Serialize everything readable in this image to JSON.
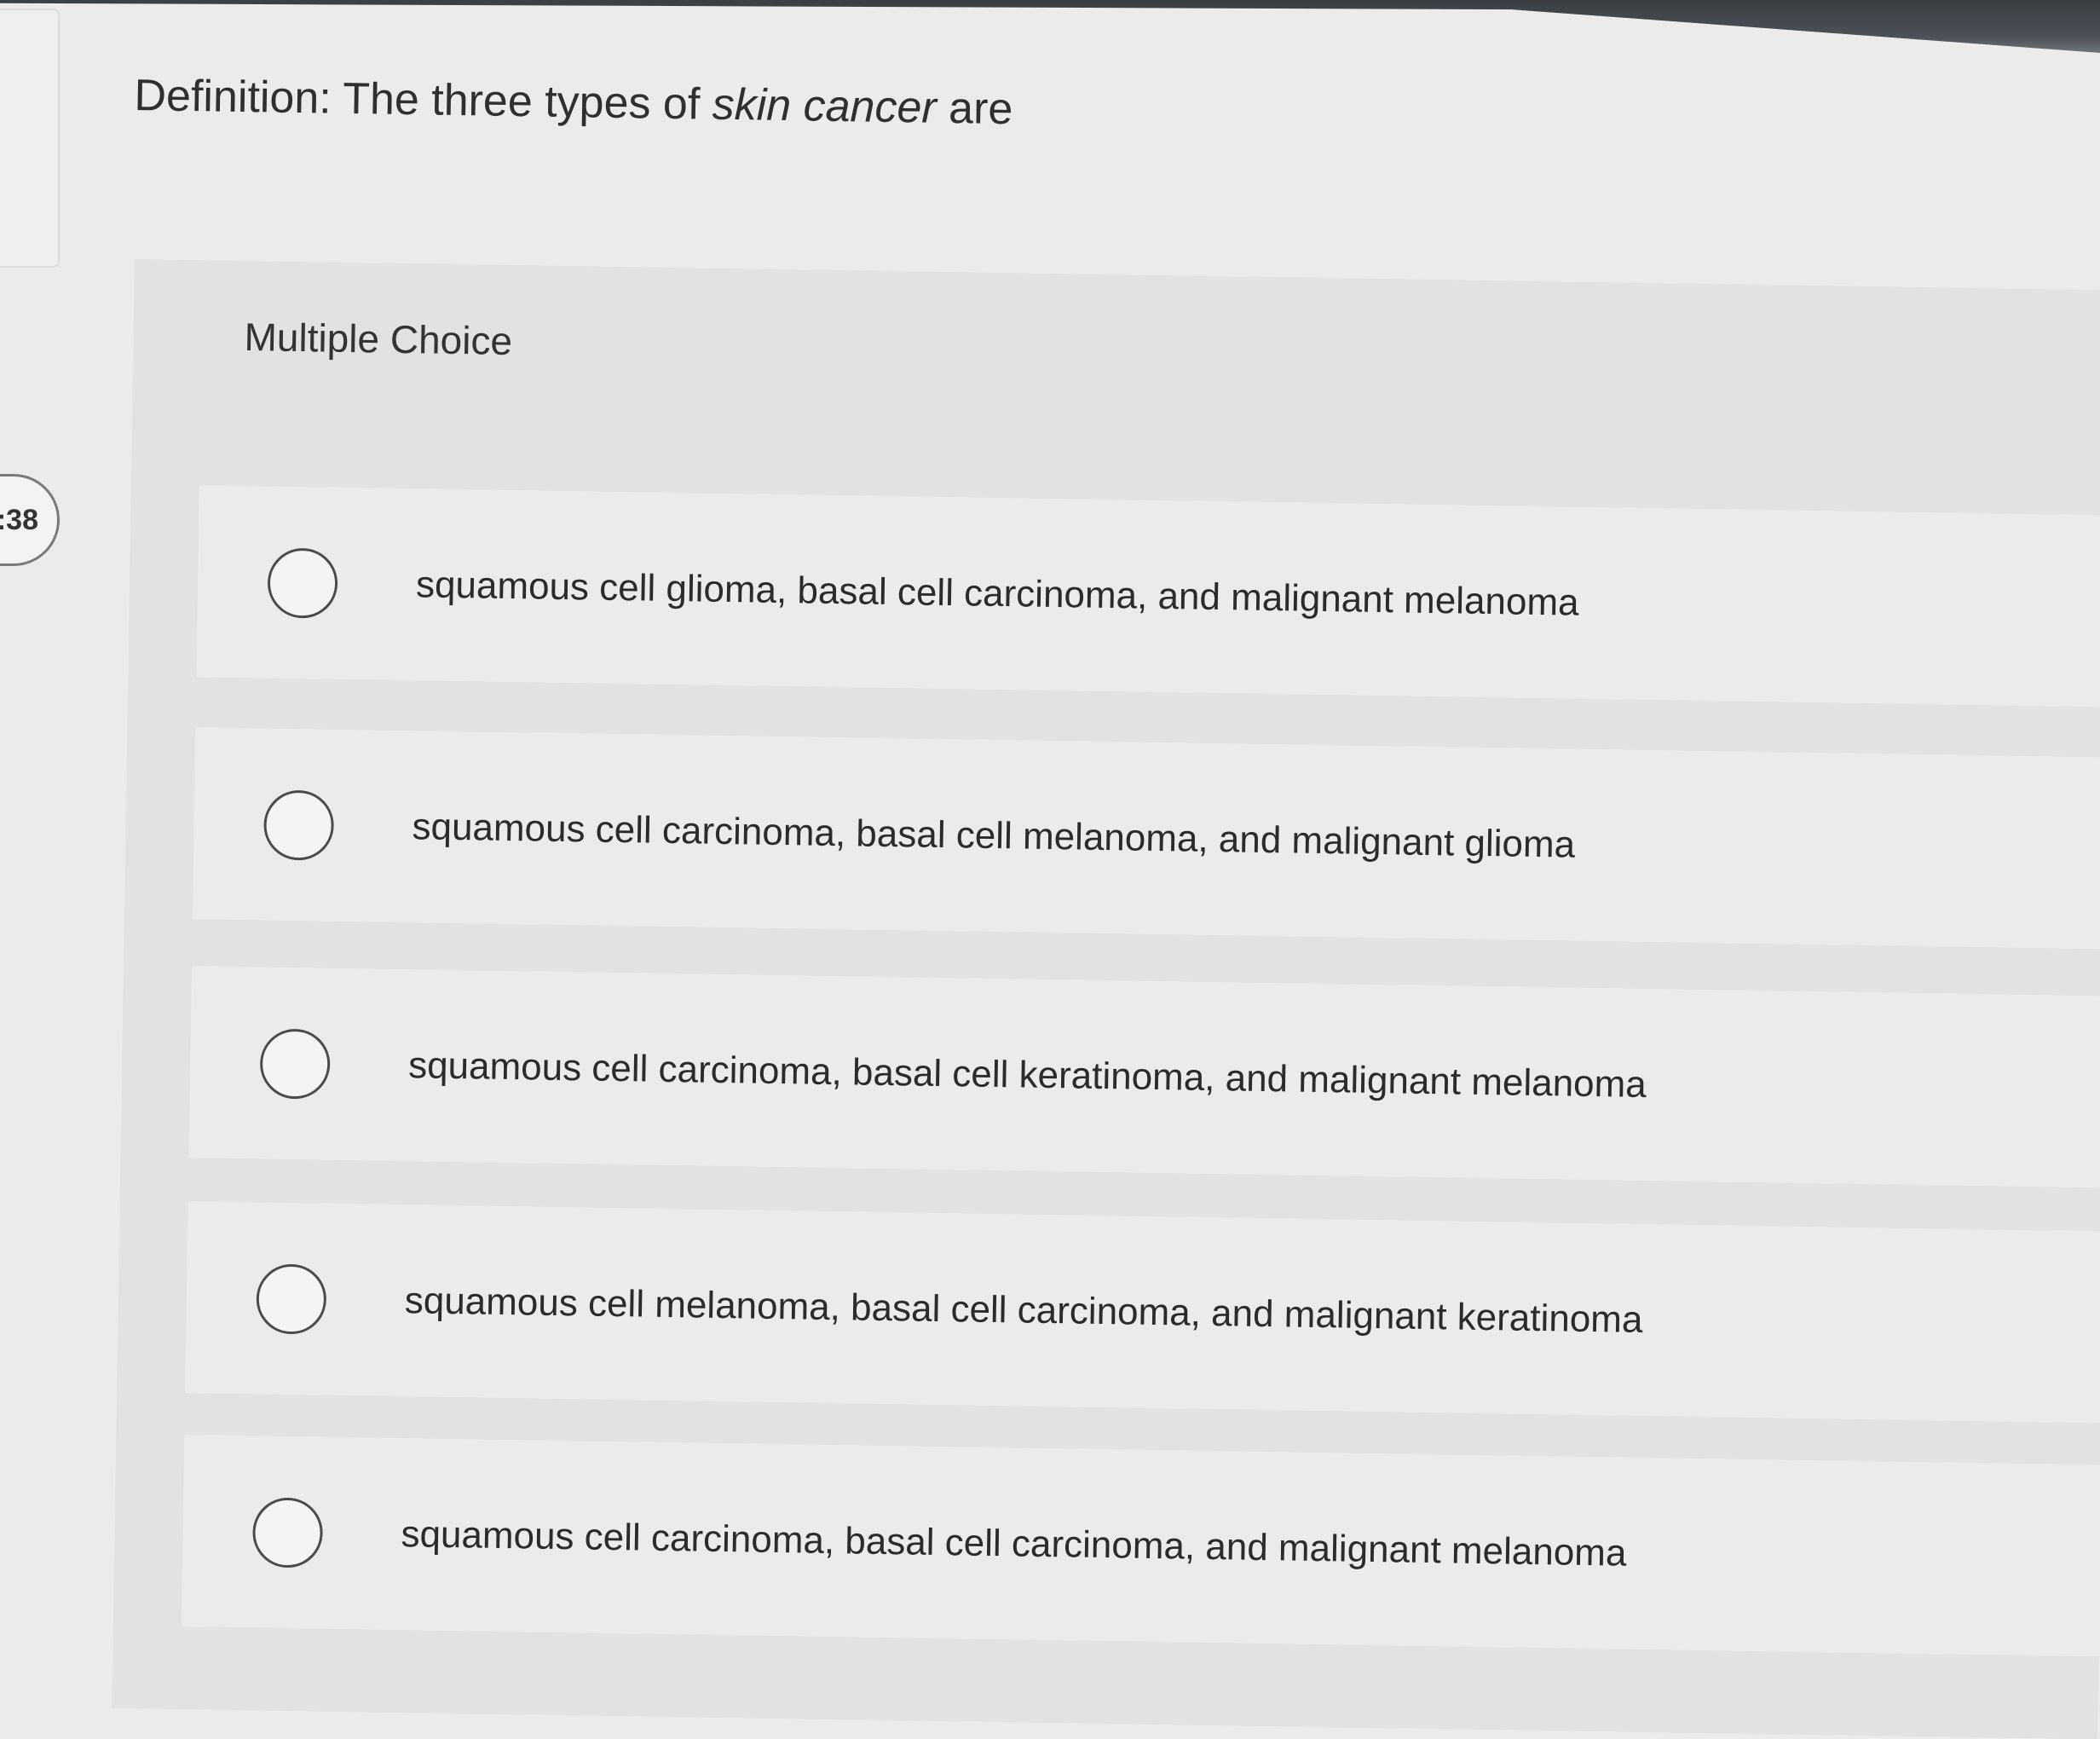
{
  "question": {
    "prefix": "Definition: The three types of ",
    "emphasis": "skin cancer",
    "suffix": " are"
  },
  "timer": {
    "label": ":38"
  },
  "multiple_choice": {
    "label": "Multiple Choice",
    "options": [
      {
        "text": "squamous cell glioma, basal cell carcinoma, and malignant melanoma"
      },
      {
        "text": "squamous cell carcinoma, basal cell melanoma, and malignant glioma"
      },
      {
        "text": "squamous cell carcinoma, basal cell keratinoma, and malignant melanoma"
      },
      {
        "text": "squamous cell melanoma, basal cell carcinoma, and malignant keratinoma"
      },
      {
        "text": "squamous cell carcinoma, basal cell carcinoma, and malignant melanoma"
      }
    ]
  }
}
